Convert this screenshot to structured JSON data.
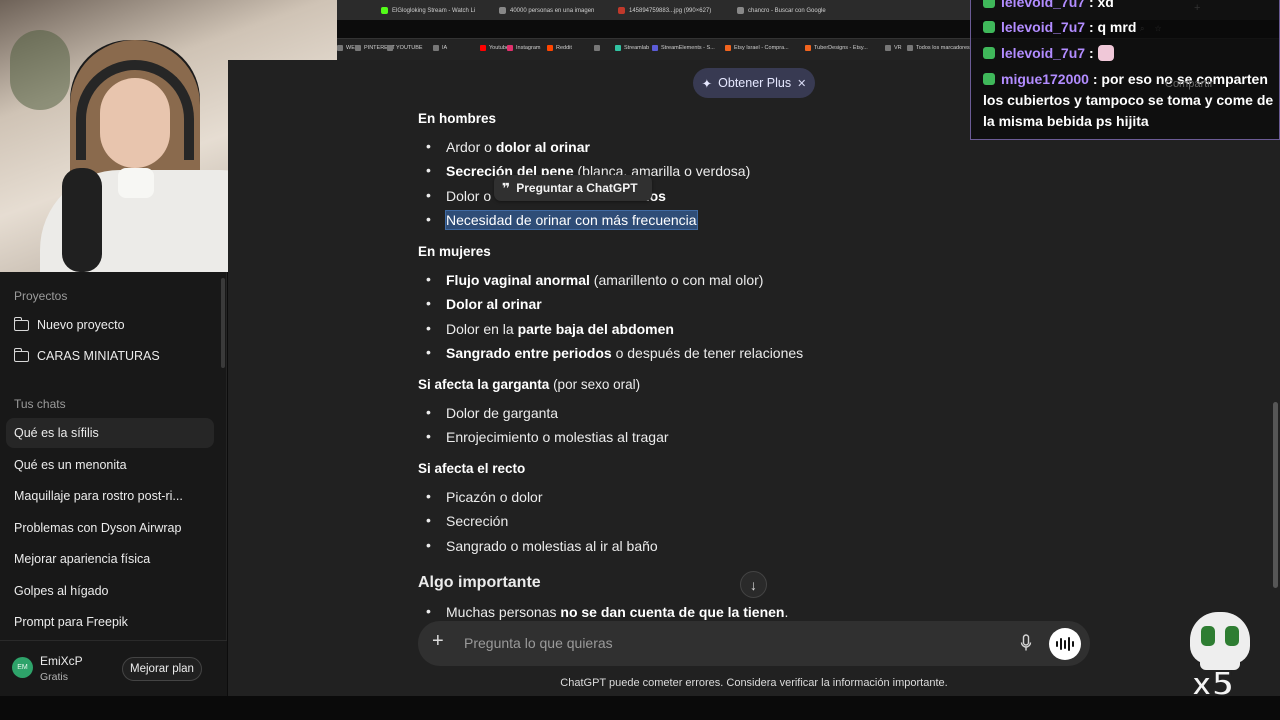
{
  "browser": {
    "tabs": [
      {
        "label": "ElGlogloking Stream - Watch Li",
        "color": "#53fc18"
      },
      {
        "label": "40000 personas en una imagen",
        "color": "#888888"
      },
      {
        "label": "145894759883...jpg (990×627)",
        "color": "#c0392b"
      },
      {
        "label": "chancro - Buscar con Google",
        "color": "#888888"
      }
    ],
    "bookmarks": [
      {
        "label": "WEB",
        "color": "#777777"
      },
      {
        "label": "PINTEREST",
        "color": "#777777"
      },
      {
        "label": "YOUTUBE",
        "color": "#777777"
      },
      {
        "label": "IA",
        "color": "#777777"
      },
      {
        "label": "Youtube",
        "color": "#ff0000"
      },
      {
        "label": "Instagram",
        "color": "#e1306c"
      },
      {
        "label": "Reddit",
        "color": "#ff4500"
      },
      {
        "label": "",
        "color": "#777777"
      },
      {
        "label": "Streamlab",
        "color": "#31c3a2"
      },
      {
        "label": "StreamElements - S...",
        "color": "#5b5bd6"
      },
      {
        "label": "Etsy Israel - Compra...",
        "color": "#f1641e"
      },
      {
        "label": "TuberDesigns - Etsy...",
        "color": "#f1641e"
      },
      {
        "label": "VR",
        "color": "#777777"
      },
      {
        "label": "Todos los marcadores",
        "color": "#777777"
      }
    ]
  },
  "sidebar": {
    "projects_title": "Proyectos",
    "projects": [
      {
        "label": "Nuevo proyecto"
      },
      {
        "label": "CARAS MINIATURAS"
      }
    ],
    "chats_title": "Tus chats",
    "chats": [
      {
        "label": "Qué es la sífilis",
        "active": true
      },
      {
        "label": "Qué es un menonita"
      },
      {
        "label": "Maquillaje para rostro post-ri..."
      },
      {
        "label": "Problemas con Dyson Airwrap"
      },
      {
        "label": "Mejorar apariencia física"
      },
      {
        "label": "Golpes al hígado"
      },
      {
        "label": "Prompt para Freepik"
      }
    ],
    "user": {
      "initials": "EM",
      "name": "EmiXcP",
      "plan": "Gratis",
      "upgrade_label": "Mejorar plan"
    }
  },
  "main": {
    "plus_button": "Obtener Plus",
    "ask_tooltip": "Preguntar a ChatGPT",
    "sections": {
      "hombres": {
        "title": "En hombres",
        "items": [
          [
            "Ardor o ",
            "dolor al orinar",
            ""
          ],
          [
            "Secreción del pene",
            " (blanca, amarilla o verdosa)",
            ""
          ],
          [
            "Dolor o",
            "",
            "ulos"
          ],
          [
            "Necesidad de orinar con más frecuencia",
            "",
            ""
          ]
        ]
      },
      "mujeres": {
        "title": "En mujeres",
        "items": [
          [
            "Flujo vaginal anormal",
            " (amarillento o con mal olor)"
          ],
          [
            "Dolor al orinar",
            ""
          ],
          [
            "Dolor en la ",
            "parte baja del abdomen"
          ],
          [
            "Sangrado entre periodos",
            " o después de tener relaciones"
          ]
        ]
      },
      "garganta": {
        "title_bold": "Si afecta la garganta",
        "title_rest": " (por sexo oral)",
        "items": [
          "Dolor de garganta",
          "Enrojecimiento o molestias al tragar"
        ]
      },
      "recto": {
        "title": "Si afecta el recto",
        "items": [
          "Picazón o dolor",
          "Secreción",
          "Sangrado o molestias al ir al baño"
        ]
      },
      "importante": {
        "title": "Algo importante",
        "items": [
          [
            "Muchas personas ",
            "no se dan cuenta de que la tienen",
            "."
          ]
        ]
      }
    },
    "composer_placeholder": "Pregunta lo que quieras",
    "disclaimer": "ChatGPT puede cometer errores. Considera verificar la información importante."
  },
  "stream_chat": [
    {
      "user": "lelevoid_7u7",
      "text": ": xd"
    },
    {
      "user": "lelevoid_7u7",
      "text": ": q mrd"
    },
    {
      "user": "lelevoid_7u7",
      "text": ":"
    },
    {
      "user": "migue172000",
      "text": ": por eso no se comparten los cubiertos y tampoco se toma y come de la misma bebida ps hijita"
    }
  ],
  "overlay": {
    "multiplier": "x5",
    "share_label": "Compartir"
  }
}
